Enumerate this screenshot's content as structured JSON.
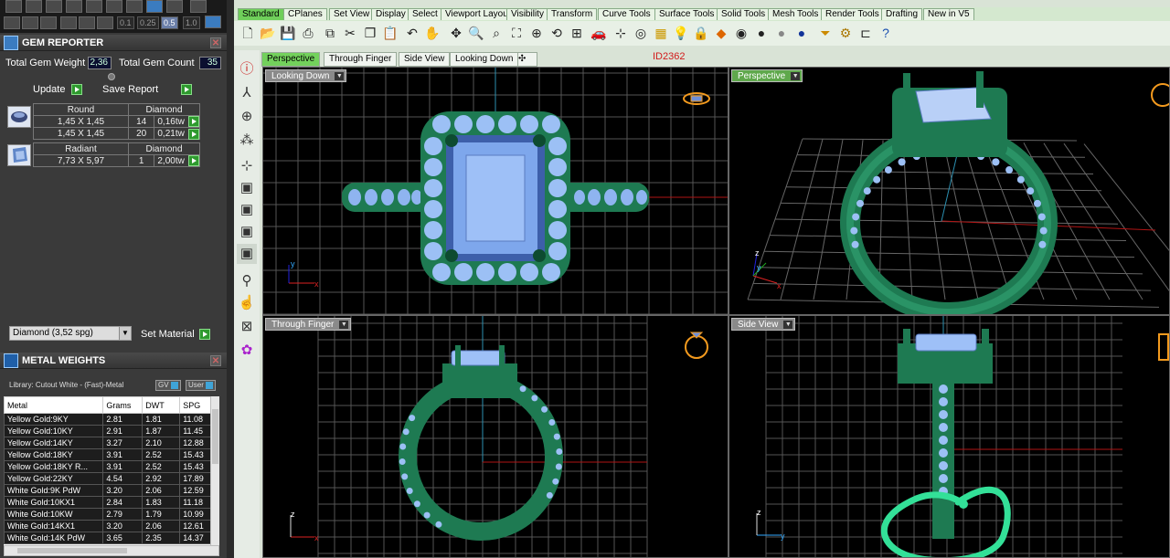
{
  "toolbar_zoom": {
    "values": [
      "0.1",
      "0.25",
      "0.5",
      "1.0"
    ],
    "selected": "0.5"
  },
  "gem_reporter": {
    "title": "GEM REPORTER",
    "total_weight_label": "Total Gem Weight",
    "total_weight_value": "2,36",
    "total_count_label": "Total Gem Count",
    "total_count_value": "35",
    "update_label": "Update",
    "save_report_label": "Save Report",
    "groups": [
      {
        "shape": "Round",
        "type": "Diamond",
        "rows": [
          {
            "size": "1,45 X 1,45",
            "count": "14",
            "weight": "0,16tw"
          },
          {
            "size": "1,45 X 1,45",
            "count": "20",
            "weight": "0,21tw"
          }
        ]
      },
      {
        "shape": "Radiant",
        "type": "Diamond",
        "rows": [
          {
            "size": "7,73 X 5,97",
            "count": "1",
            "weight": "2,00tw"
          }
        ]
      }
    ],
    "material_selected": "Diamond    (3,52 spg)",
    "set_material_label": "Set Material"
  },
  "metal_weights": {
    "title": "METAL WEIGHTS",
    "library_label": "Library: Cutout White - (Fast)-Metal",
    "gv_label": "GV",
    "user_label": "User",
    "columns": [
      "Metal",
      "Grams",
      "DWT",
      "SPG"
    ],
    "rows": [
      [
        "Yellow Gold:9KY",
        "2.81",
        "1.81",
        "11.08"
      ],
      [
        "Yellow Gold:10KY",
        "2.91",
        "1.87",
        "11.45"
      ],
      [
        "Yellow Gold:14KY",
        "3.27",
        "2.10",
        "12.88"
      ],
      [
        "Yellow Gold:18KY",
        "3.91",
        "2.52",
        "15.43"
      ],
      [
        "Yellow Gold:18KY R...",
        "3.91",
        "2.52",
        "15.43"
      ],
      [
        "Yellow Gold:22KY",
        "4.54",
        "2.92",
        "17.89"
      ],
      [
        "White Gold:9K PdW",
        "3.20",
        "2.06",
        "12.59"
      ],
      [
        "White Gold:10KX1",
        "2.84",
        "1.83",
        "11.18"
      ],
      [
        "White Gold:10KW",
        "2.79",
        "1.79",
        "10.99"
      ],
      [
        "White Gold:14KX1",
        "3.20",
        "2.06",
        "12.61"
      ],
      [
        "White Gold:14K PdW",
        "3.65",
        "2.35",
        "14.37"
      ]
    ]
  },
  "tabs": [
    "Standard",
    "CPlanes",
    "Set View",
    "Display",
    "Select",
    "Viewport Layout",
    "Visibility",
    "Transform",
    "Curve Tools",
    "Surface Tools",
    "Solid Tools",
    "Mesh Tools",
    "Render Tools",
    "Drafting",
    "New in V5"
  ],
  "viewport_tabs": [
    "Perspective",
    "Through Finger",
    "Side View",
    "Looking Down"
  ],
  "id_label": "ID2362",
  "viewports": {
    "top_left": "Looking Down",
    "top_right": "Perspective",
    "bottom_left": "Through Finger",
    "bottom_right": "Side View"
  },
  "axes": {
    "x": "x",
    "y": "y",
    "z": "z"
  },
  "colors": {
    "accent_green": "#6fcf5a",
    "ring_green": "#1e7a52",
    "gem_blue": "#8fb4f0",
    "active_tab": "#73d15c"
  }
}
